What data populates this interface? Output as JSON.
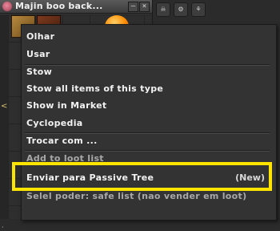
{
  "inventory_window": {
    "title": "Majin boo back...",
    "minimize_symbol": "–",
    "close_symbol": "×",
    "side_marker": "<",
    "bottom_mark": "·"
  },
  "toolbar": {
    "icons": [
      {
        "name": "skull-icon",
        "glyph": "☠"
      },
      {
        "name": "sort-icon",
        "glyph": "⚙"
      },
      {
        "name": "settings-icon",
        "glyph": "⚘"
      }
    ]
  },
  "context_menu": {
    "items": {
      "olhar": "Olhar",
      "usar": "Usar",
      "stow": "Stow",
      "stow_all": "Stow all items of this type",
      "show_market": "Show in Market",
      "cyclopedia": "Cyclopedia",
      "trocar": "Trocar com ...",
      "add_loot_list": "Add to loot list",
      "enviar_passive": "Enviar para Passive Tree",
      "new_badge": "(New)",
      "set_sell_list": "Selel poder: safe list (nao vender em loot)"
    }
  },
  "colors": {
    "highlight": "#ffe400",
    "menu_bg": "#333333",
    "menu_text": "#f2f2f2"
  }
}
